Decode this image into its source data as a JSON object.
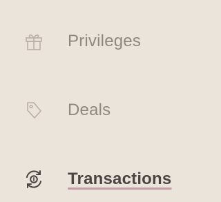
{
  "nav": {
    "items": [
      {
        "label": "Privileges",
        "icon": "gift-icon",
        "active": false
      },
      {
        "label": "Deals",
        "icon": "tag-icon",
        "active": false
      },
      {
        "label": "Transactions",
        "icon": "currency-exchange-icon",
        "active": true
      }
    ]
  },
  "colors": {
    "background": "#ebe4db",
    "inactive_text": "#8f8880",
    "active_text": "#4a4541",
    "active_underline": "#c49ba3",
    "inactive_icon": "#b8b0a8",
    "active_icon": "#4a4541"
  }
}
